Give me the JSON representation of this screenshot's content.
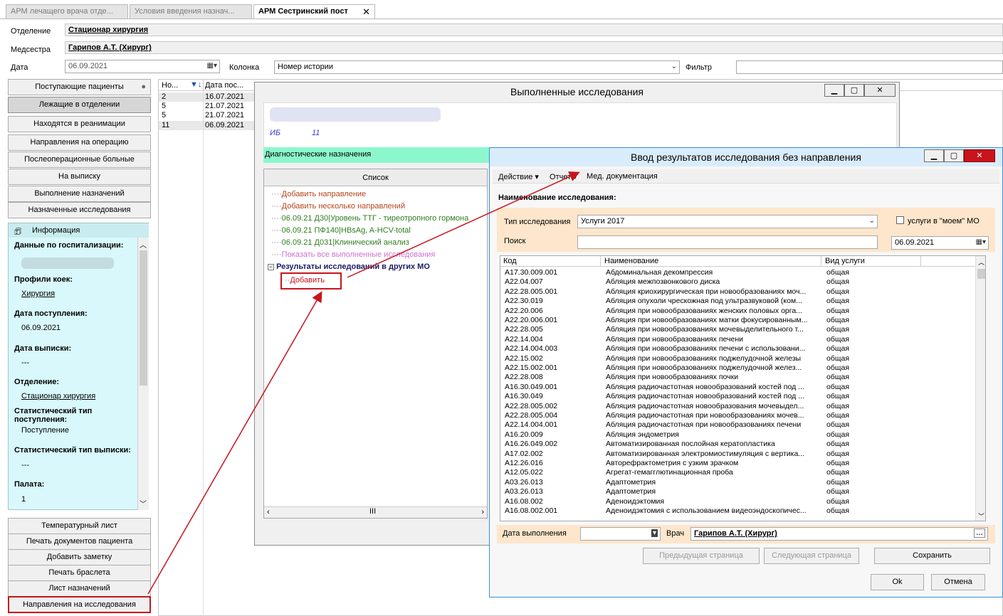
{
  "tabs": [
    {
      "label": "АРМ лечащего врача отде..."
    },
    {
      "label": "Условия введения назнач..."
    },
    {
      "label": "АРМ Сестринский пост"
    }
  ],
  "header": {
    "department_label": "Отделение",
    "department_value": "Стационар хирургия",
    "nurse_label": "Медсестра",
    "nurse_value": "Гарипов А.Т. (Хирург)",
    "date_label": "Дата",
    "date_value": "06.09.2021",
    "column_label": "Колонка",
    "column_value": "Номер истории",
    "filter_label": "Фильтр"
  },
  "nav": {
    "top": [
      "Поступающие пациенты",
      "Лежащие в отделении",
      "Находятся в реанимации",
      "Направления на операцию",
      "Послеоперационные больные",
      "На выписку",
      "Выполнение назначений",
      "Назначенные исследования"
    ],
    "bottom": [
      "Температурный лист",
      "Печать документов пациента",
      "Добавить заметку",
      "Печать браслета",
      "Лист назначений",
      "Направления на исследования"
    ]
  },
  "info": {
    "title": "Информация",
    "hosp_label": "Данные по госпитализации:",
    "profile_label": "Профили коек:",
    "profile_value": "Хирургия",
    "admit_label": "Дата поступления:",
    "admit_value": "06.09.2021",
    "discharge_label": "Дата выписки:",
    "discharge_value": "---",
    "dept_label": "Отделение:",
    "dept_value": "Стационар хирургия",
    "stat_admit_label": "Статистический тип поступления:",
    "stat_admit_value": "Поступление",
    "stat_disch_label": "Статистический тип выписки:",
    "stat_disch_value": "---",
    "ward_label": "Палата:",
    "ward_value": "1"
  },
  "patients": {
    "col_no": "Но...",
    "col_date": "Дата пос...",
    "rows": [
      {
        "no": "2",
        "date": "16.07.2021"
      },
      {
        "no": "5",
        "date": "21.07.2021"
      },
      {
        "no": "5",
        "date": "21.07.2021"
      },
      {
        "no": "11",
        "date": "06.09.2021"
      }
    ]
  },
  "exams_window": {
    "title": "Выполненные исследования",
    "ib_label": "ИБ",
    "ib_value": "11",
    "diag_label": "Диагностические назначения",
    "list_header": "Список",
    "tree": [
      {
        "text": "Добавить направление",
        "color": "#b5451b"
      },
      {
        "text": "Добавить несколько направлений",
        "color": "#b5451b"
      },
      {
        "text": "06.09.21 Д30|Уровень ТТГ - тиреотропного гормона",
        "color": "#2e7d1e"
      },
      {
        "text": "06.09.21 ПФ140|HBsAg, A-HCV-total",
        "color": "#2e7d1e"
      },
      {
        "text": "06.09.21 Д031|Клинический анализ",
        "color": "#2e7d1e"
      },
      {
        "text": "Показать все выполненные исследования",
        "color": "#d070d0"
      }
    ],
    "results_node": "Результаты исследований в других МО",
    "add_node": "Добавить"
  },
  "input_window": {
    "title": "Ввод результатов исследования без направления",
    "menu": [
      "Действие ▾",
      "Отчет ▾",
      "Мед. документация"
    ],
    "name_label": "Наименование исследования:",
    "type_label": "Тип исследования",
    "type_value": "Услуги 2017",
    "my_mo_label": "услуги в \"моем\" МО",
    "search_label": "Поиск",
    "search_date": "06.09.2021",
    "col_code": "Код",
    "col_name": "Наименование",
    "col_kind": "Вид услуги",
    "rows": [
      {
        "code": "A17.30.009.001",
        "name": "Абдоминальная декомпрессия",
        "kind": "общая"
      },
      {
        "code": "A22.04.007",
        "name": "Абляция межпозвонкового диска",
        "kind": "общая"
      },
      {
        "code": "A22.28.005.001",
        "name": "Абляция криохирургическая при новообразованиях моч...",
        "kind": "общая"
      },
      {
        "code": "A22.30.019",
        "name": "Абляция опухоли чрескожная под ультразвуковой (ком...",
        "kind": "общая"
      },
      {
        "code": "A22.20.006",
        "name": "Абляция при новообразованиях женских половых орга...",
        "kind": "общая"
      },
      {
        "code": "A22.20.006.001",
        "name": "Абляция при новообразованиях матки фокусированным...",
        "kind": "общая"
      },
      {
        "code": "A22.28.005",
        "name": "Абляция при новообразованиях мочевыделительного т...",
        "kind": "общая"
      },
      {
        "code": "A22.14.004",
        "name": "Абляция при новообразованиях печени",
        "kind": "общая"
      },
      {
        "code": "A22.14.004.003",
        "name": "Абляция при новообразованиях печени с использовани...",
        "kind": "общая"
      },
      {
        "code": "A22.15.002",
        "name": "Абляция при новообразованиях поджелудочной железы",
        "kind": "общая"
      },
      {
        "code": "A22.15.002.001",
        "name": "Абляция при новообразованиях поджелудочной желез...",
        "kind": "общая"
      },
      {
        "code": "A22.28.008",
        "name": "Абляция при новообразованиях почки",
        "kind": "общая"
      },
      {
        "code": "A16.30.049.001",
        "name": "Абляция радиочастотная новообразований костей под ...",
        "kind": "общая"
      },
      {
        "code": "A16.30.049",
        "name": "Абляция радиочастотная новообразований костей под ...",
        "kind": "общая"
      },
      {
        "code": "A22.28.005.002",
        "name": "Абляция радиочастотная новообразования мочевыдел...",
        "kind": "общая"
      },
      {
        "code": "A22.28.005.004",
        "name": "Абляция радиочастотная при новообразованиях мочев...",
        "kind": "общая"
      },
      {
        "code": "A22.14.004.001",
        "name": "Абляция радиочастотная при новообразованиях печени",
        "kind": "общая"
      },
      {
        "code": "A16.20.009",
        "name": "Абляция эндометрия",
        "kind": "общая"
      },
      {
        "code": "A16.26.049.002",
        "name": "Автоматизированная послойная кератопластика",
        "kind": "общая"
      },
      {
        "code": "A17.02.002",
        "name": "Автоматизированная электромиостимуляция с вертика...",
        "kind": "общая"
      },
      {
        "code": "A12.26.016",
        "name": "Авторефрактометрия с узким зрачком",
        "kind": "общая"
      },
      {
        "code": "A12.05.022",
        "name": "Агрегат-гемагглютинационная проба",
        "kind": "общая"
      },
      {
        "code": "A03.26.013",
        "name": "Адаптометрия",
        "kind": "общая"
      },
      {
        "code": "A03.26.013",
        "name": "Адаптометрия",
        "kind": "общая"
      },
      {
        "code": "A16.08.002",
        "name": "Аденоидэктомия",
        "kind": "общая"
      },
      {
        "code": "A16.08.002.001",
        "name": "Аденоидэктомия с использованием видеоэндоскопичес...",
        "kind": "общая"
      }
    ],
    "exec_date_label": "Дата выполнения",
    "doctor_label": "Врач",
    "doctor_value": "Гарипов А.Т. (Хирург)",
    "prev_page": "Предыдущая страница",
    "next_page": "Следующая страница",
    "save": "Сохранить",
    "ok": "Ok",
    "cancel": "Отмена"
  }
}
